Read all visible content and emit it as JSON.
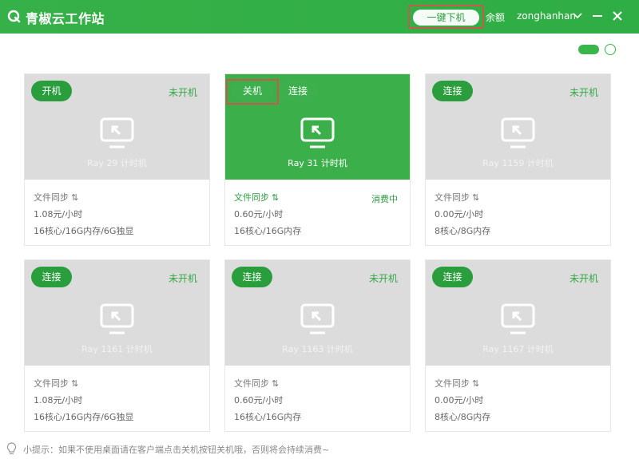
{
  "app": {
    "title": "青椒云工作站",
    "oneclick_label": "一键下机",
    "balance_label": "余额",
    "username": "zonghanhan",
    "icons": [
      "logo-icon",
      "chevron-down-icon",
      "minimize-icon",
      "close-icon"
    ]
  },
  "colors": {
    "brand": "#39b54a",
    "brand_dark": "#2a9d3d",
    "card_gray": "#dcdcdc",
    "highlight": "#c7594d"
  },
  "cards": [
    {
      "buttons": [
        "开机"
      ],
      "status": "未开机",
      "name": "Ray 29 计时机",
      "sync": "文件同步",
      "price": "1.08元/小时",
      "spec": "16核心/16G内存/6G独显",
      "consuming": ""
    },
    {
      "buttons": [
        "关机",
        "连接"
      ],
      "status": "",
      "name": "Ray 31 计时机",
      "sync": "文件同步",
      "price": "0.60元/小时",
      "spec": "16核心/16G内存",
      "consuming": "消费中"
    },
    {
      "buttons": [
        "连接"
      ],
      "status": "未开机",
      "name": "Ray 1159 计时机",
      "sync": "文件同步",
      "price": "0.00元/小时",
      "spec": "8核心/8G内存",
      "consuming": ""
    },
    {
      "buttons": [
        "连接"
      ],
      "status": "未开机",
      "name": "Ray 1161 计时机",
      "sync": "文件同步",
      "price": "1.08元/小时",
      "spec": "16核心/16G内存/6G独显",
      "consuming": ""
    },
    {
      "buttons": [
        "连接"
      ],
      "status": "未开机",
      "name": "Ray 1163 计时机",
      "sync": "文件同步",
      "price": "0.60元/小时",
      "spec": "16核心/16G内存",
      "consuming": ""
    },
    {
      "buttons": [
        "连接"
      ],
      "status": "未开机",
      "name": "Ray 1167 计时机",
      "sync": "文件同步",
      "price": "0.00元/小时",
      "spec": "8核心/8G内存",
      "consuming": ""
    }
  ],
  "footer": {
    "hint": "小提示：如果不使用桌面请在客户端点击关机按钮关机哦，否则将会持续消费~"
  }
}
